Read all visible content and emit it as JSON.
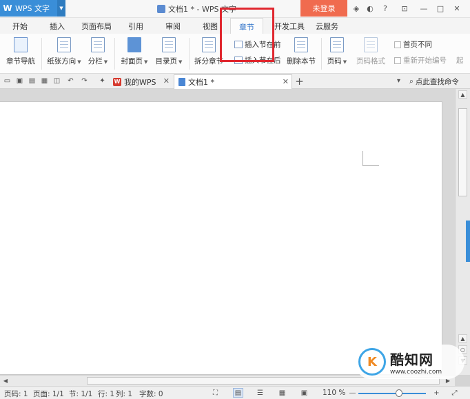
{
  "titlebar": {
    "app_name": "WPS 文字",
    "doc_title": "文档1 * - WPS 文字",
    "login_label": "未登录",
    "icons": [
      "skin-icon",
      "theme-icon",
      "help-icon",
      "minimize-icon",
      "restore-icon",
      "close-icon"
    ]
  },
  "tabs": [
    "开始",
    "插入",
    "页面布局",
    "引用",
    "审阅",
    "视图",
    "章节",
    "开发工具",
    "云服务"
  ],
  "active_tab": "章节",
  "ribbon": {
    "nav_label": "章节导航",
    "orientation_label": "纸张方向",
    "columns_label": "分栏",
    "cover_label": "封面页",
    "toc_label": "目录页",
    "split_label": "拆分章节",
    "insert_before_label": "插入节在前",
    "insert_after_label": "插入节在后",
    "delete_section_label": "删除本节",
    "page_number_label": "页码",
    "page_number_format_label": "页码格式",
    "first_page_diff_label": "首页不同",
    "restart_numbering_label": "重新开始编号",
    "partial_label": "起"
  },
  "quickbar": {
    "tab_mywps": "我的WPS",
    "tab_doc": "文档1 *",
    "search_label": "点此查找命令"
  },
  "status": {
    "page_number": "页码: 1",
    "pages": "页面: 1/1",
    "section": "节: 1/1",
    "row": "行: 1",
    "column": "列: 1",
    "word_count": "字数: 0",
    "zoom": "110 %"
  },
  "watermark": {
    "title": "酷知网",
    "url": "www.coozhi.com"
  },
  "colors": {
    "accent": "#3a8ed8",
    "login": "#f06b4f",
    "highlight": "#e0272f"
  }
}
